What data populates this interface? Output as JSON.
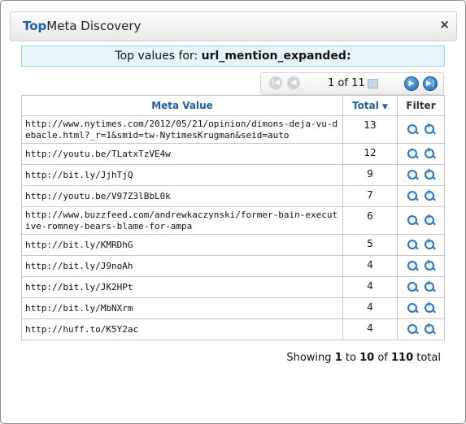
{
  "title": {
    "brand": "Top",
    "rest": "Meta Discovery"
  },
  "close_label": "×",
  "top_values": {
    "prefix": "Top values for:",
    "field": "url_mention_expanded:"
  },
  "pager": {
    "text": "1 of 11"
  },
  "table": {
    "headers": {
      "meta": "Meta Value",
      "total": "Total",
      "sort_arrow": "▼",
      "filter": "Filter"
    },
    "rows": [
      {
        "value": "http://www.nytimes.com/2012/05/21/opinion/dimons-deja-vu-debacle.html?_r=1&smid=tw-NytimesKrugman&seid=auto",
        "total": "13"
      },
      {
        "value": "http://youtu.be/TLatxTzVE4w",
        "total": "12"
      },
      {
        "value": "http://bit.ly/JjhTjQ",
        "total": "9"
      },
      {
        "value": "http://youtu.be/V97Z3lBbL0k",
        "total": "7"
      },
      {
        "value": "http://www.buzzfeed.com/andrewkaczynski/former-bain-executive-romney-bears-blame-for-ampa",
        "total": "6"
      },
      {
        "value": "http://bit.ly/KMRDhG",
        "total": "5"
      },
      {
        "value": "http://bit.ly/J9noAh",
        "total": "4"
      },
      {
        "value": "http://bit.ly/JK2HPt",
        "total": "4"
      },
      {
        "value": "http://bit.ly/MbNXrm",
        "total": "4"
      },
      {
        "value": "http://huff.to/K5Y2ac",
        "total": "4"
      }
    ]
  },
  "footer": {
    "showing": "Showing",
    "from": "1",
    "to_word": "to",
    "to": "10",
    "of_word": "of",
    "total": "110",
    "total_word": "total"
  },
  "icons": {
    "search": "magnifier-icon",
    "add_filter": "magnifier-plus-icon"
  }
}
